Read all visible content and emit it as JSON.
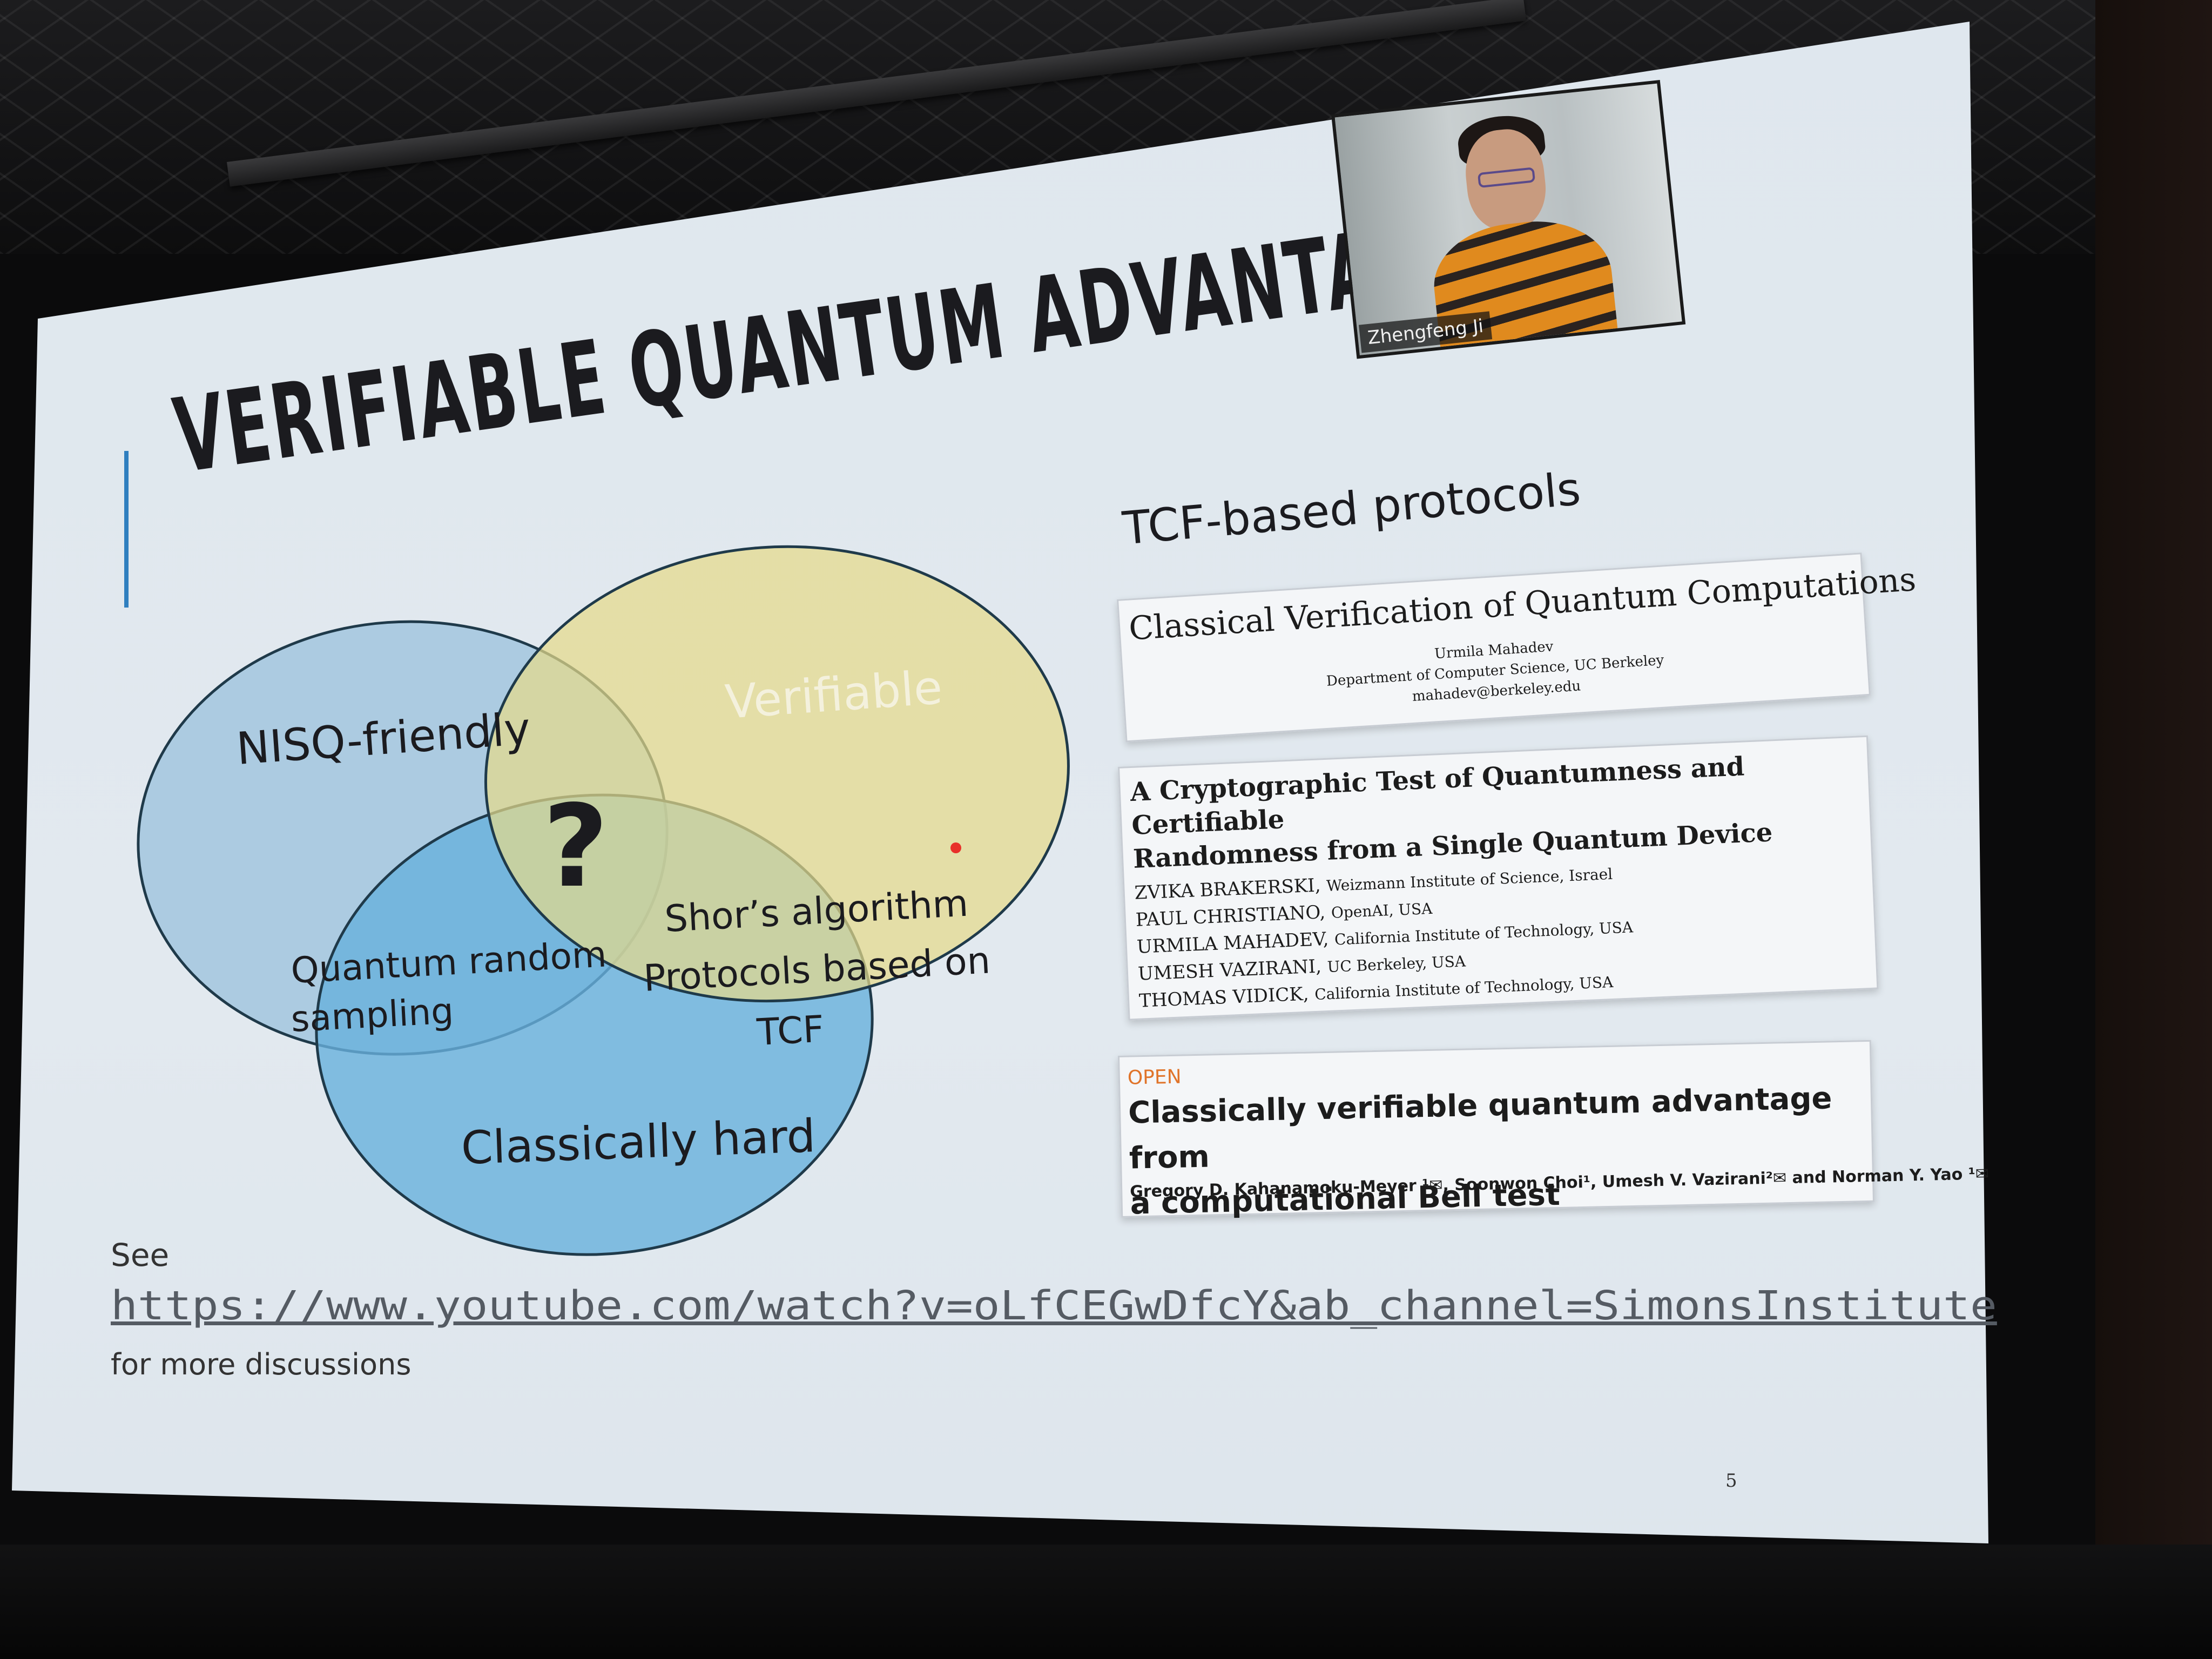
{
  "slide": {
    "title": "VERIFIABLE QUANTUM ADVANTAGE",
    "page_number": "5"
  },
  "venn": {
    "nisq_label": "NISQ-friendly",
    "verifiable_label": "Verifiable",
    "center_label": "?",
    "quantum_random_line1": "Quantum random",
    "quantum_random_line2": "sampling",
    "shor_line1": "Shor’s algorithm",
    "shor_line2": "Protocols based on",
    "shor_line3": "TCF",
    "classically_hard_label": "Classically hard",
    "colors": {
      "nisq_fill": "#9fc3dd",
      "verifiable_fill": "#e5d98a",
      "classically_hard_fill": "#68b0dc",
      "outline": "#1f3a4a"
    }
  },
  "video": {
    "participant_name": "Zhengfeng Ji"
  },
  "protocols": {
    "heading": "TCF-based protocols",
    "paper1": {
      "title": "Classical Verification of Quantum Computations",
      "author": "Urmila Mahadev",
      "affiliation": "Department of Computer Science, UC Berkeley",
      "email": "mahadev@berkeley.edu"
    },
    "paper2": {
      "title_line1": "A Cryptographic Test of Quantumness and Certifiable",
      "title_line2": "Randomness from a Single Quantum Device",
      "authors": [
        {
          "name": "ZVIKA BRAKERSKI,",
          "affiliation": "Weizmann Institute of Science, Israel"
        },
        {
          "name": "PAUL CHRISTIANO,",
          "affiliation": "OpenAI, USA"
        },
        {
          "name": "URMILA MAHADEV,",
          "affiliation": "California Institute of Technology, USA"
        },
        {
          "name": "UMESH VAZIRANI,",
          "affiliation": "UC Berkeley, USA"
        },
        {
          "name": "THOMAS VIDICK,",
          "affiliation": "California Institute of Technology, USA"
        }
      ]
    },
    "paper3": {
      "badge": "OPEN",
      "title_line1": "Classically verifiable quantum advantage from",
      "title_line2": "a computational Bell test",
      "authors": "Gregory D. Kahanamoku-Meyer ¹✉, Soonwon Choi¹, Umesh V. Vazirani²✉ and Norman Y. Yao ¹✉"
    }
  },
  "footer": {
    "see": "See",
    "url": "https://www.youtube.com/watch?v=oLfCEGwDfcY&ab_channel=SimonsInstitute",
    "more": "for more discussions"
  }
}
